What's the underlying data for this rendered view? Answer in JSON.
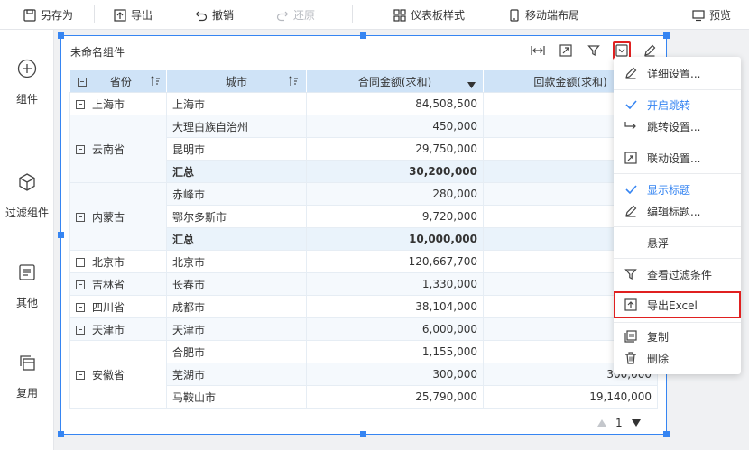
{
  "toolbar": {
    "save_as": "另存为",
    "export": "导出",
    "undo": "撤销",
    "redo": "还原",
    "dashboard_style": "仪表板样式",
    "mobile_layout": "移动端布局",
    "preview": "预览"
  },
  "sidebar": {
    "items": [
      {
        "label": "组件",
        "icon": "plus-circle-icon"
      },
      {
        "label": "过滤组件",
        "icon": "cube-icon"
      },
      {
        "label": "其他",
        "icon": "list-box-icon"
      },
      {
        "label": "复用",
        "icon": "copy-stack-icon"
      }
    ]
  },
  "widget": {
    "title": "未命名组件",
    "tools": [
      "expand-width-icon",
      "fullscreen-icon",
      "filter-icon",
      "chevron-down-icon",
      "edit-icon"
    ]
  },
  "table": {
    "headers": [
      "省份",
      "城市",
      "合同金额(求和)",
      "回款金额(求和)"
    ],
    "rows": [
      {
        "province": "上海市",
        "city": "上海市",
        "contract": "84,508,500",
        "payment": "59,1"
      },
      {
        "province": "云南省",
        "city": "大理白族自治州",
        "contract": "450,000",
        "payment": "4"
      },
      {
        "province": "",
        "city": "昆明市",
        "contract": "29,750,000",
        "payment": "23,0"
      },
      {
        "province": "",
        "city": "汇总",
        "contract": "30,200,000",
        "payment": "23,5"
      },
      {
        "province": "内蒙古",
        "city": "赤峰市",
        "contract": "280,000",
        "payment": "2"
      },
      {
        "province": "",
        "city": "鄂尔多斯市",
        "contract": "9,720,000",
        "payment": "7,5"
      },
      {
        "province": "",
        "city": "汇总",
        "contract": "10,000,000",
        "payment": "7,8"
      },
      {
        "province": "北京市",
        "city": "北京市",
        "contract": "120,667,700",
        "payment": "75,2"
      },
      {
        "province": "吉林省",
        "city": "长春市",
        "contract": "1,330,000",
        "payment": "6"
      },
      {
        "province": "四川省",
        "city": "成都市",
        "contract": "38,104,000",
        "payment": "29,1"
      },
      {
        "province": "天津市",
        "city": "天津市",
        "contract": "6,000,000",
        "payment": "4,6"
      },
      {
        "province": "安徽省",
        "city": "合肥市",
        "contract": "1,155,000",
        "payment": "9"
      },
      {
        "province": "",
        "city": "芜湖市",
        "contract": "300,000",
        "payment": "300,000"
      },
      {
        "province": "",
        "city": "马鞍山市",
        "contract": "25,790,000",
        "payment": "19,140,000"
      }
    ]
  },
  "pager": {
    "page": "1"
  },
  "menu": {
    "items": [
      {
        "label": "详细设置...",
        "icon": "pencil-icon"
      },
      {
        "label": "开启跳转",
        "icon": "check-icon"
      },
      {
        "label": "跳转设置...",
        "icon": "redirect-icon"
      },
      {
        "label": "联动设置...",
        "icon": "link-icon"
      },
      {
        "label": "显示标题",
        "icon": "check-icon"
      },
      {
        "label": "编辑标题...",
        "icon": "pencil-icon"
      },
      {
        "label": "悬浮",
        "icon": ""
      },
      {
        "label": "查看过滤条件",
        "icon": "filter-icon"
      },
      {
        "label": "导出Excel",
        "icon": "export-icon"
      },
      {
        "label": "复制",
        "icon": "copy-icon"
      },
      {
        "label": "删除",
        "icon": "trash-icon"
      }
    ]
  },
  "colors": {
    "accent": "#3685f2",
    "highlight": "#e02020",
    "header_bg": "#cfe3f7"
  }
}
